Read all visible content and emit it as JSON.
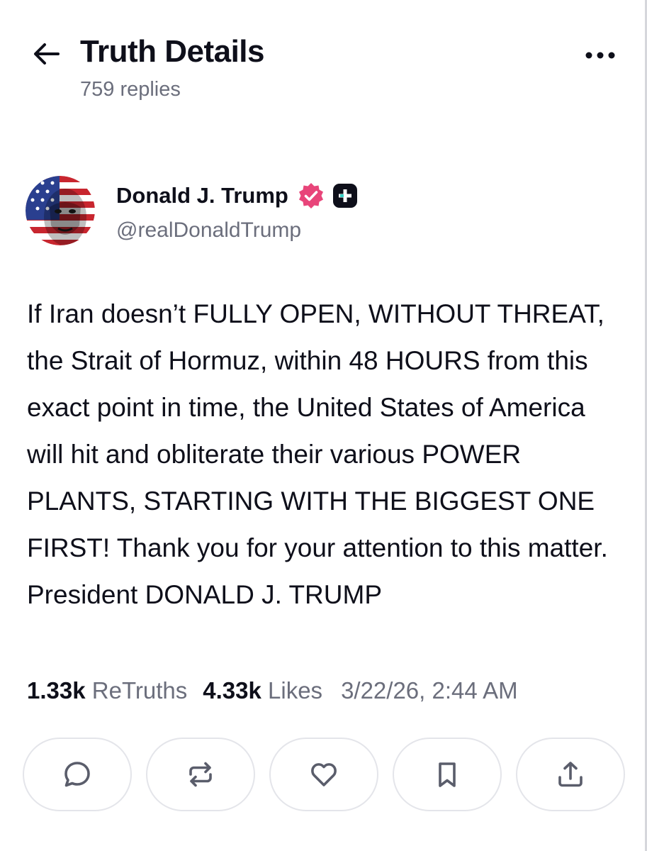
{
  "header": {
    "title": "Truth Details",
    "replies": "759 replies",
    "back_icon": "arrow-left-icon",
    "more_icon": "more-horizontal-icon"
  },
  "author": {
    "name": "Donald J. Trump",
    "handle": "@realDonaldTrump",
    "verified_icon": "verified-badge-icon",
    "verified_color": "#e8457a",
    "plus_icon": "truth-plus-badge-icon"
  },
  "post": {
    "text": "If Iran doesn’t FULLY OPEN, WITHOUT THREAT, the Strait of Hormuz, within 48 HOURS from this exact point in time, the United States of America will hit and obliterate their various POWER PLANTS, STARTING WITH THE BIGGEST ONE FIRST! Thank you for your attention to this matter. President DONALD J. TRUMP"
  },
  "stats": {
    "retruths_count": "1.33k",
    "retruths_label": "ReTruths",
    "likes_count": "4.33k",
    "likes_label": "Likes",
    "timestamp": "3/22/26, 2:44 AM"
  },
  "actions": [
    {
      "icon": "reply-icon"
    },
    {
      "icon": "retruth-icon"
    },
    {
      "icon": "like-heart-icon"
    },
    {
      "icon": "bookmark-icon"
    },
    {
      "icon": "share-icon"
    }
  ],
  "colors": {
    "text_primary": "#0e0f1a",
    "text_secondary": "#6b6e7c",
    "border": "#e4e5ea",
    "icon": "#5a5d6b"
  }
}
